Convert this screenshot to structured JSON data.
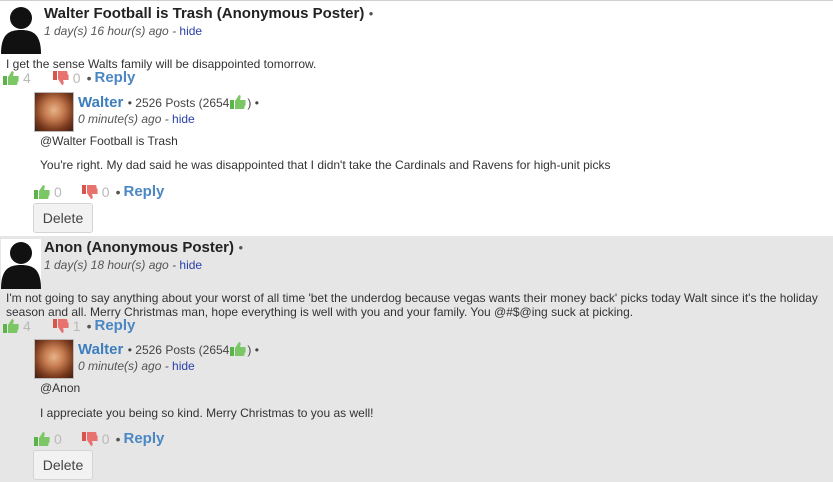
{
  "colors": {
    "accent_link": "#4a87c3",
    "hide_link": "#2a3fa8",
    "thumb_up": "#5cb34a",
    "thumb_down": "#e05a55",
    "alt_background": "#e6e6e6"
  },
  "comments": [
    {
      "poster": "Walter Football is Trash (Anonymous Poster)",
      "bullet": "•",
      "time": "1 day(s) 16 hour(s) ago -",
      "hide": "hide",
      "text": "I get the sense Walts family will be disappointed tomorrow.",
      "up_count": "4",
      "down_count": "0",
      "reply": "Reply",
      "reply_item": {
        "name": "Walter",
        "posts": "• 2526 Posts (2654",
        "posts_close": ") •",
        "time": "0 minute(s) ago -",
        "hide": "hide",
        "mention": "@Walter Football is Trash",
        "text": "You're right. My dad said he was disappointed that I didn't take the Cardinals and Ravens for high-unit picks",
        "up_count": "0",
        "down_count": "0",
        "reply": "Reply",
        "delete": "Delete"
      }
    },
    {
      "poster": "Anon (Anonymous Poster)",
      "bullet": "•",
      "time": "1 day(s) 18 hour(s) ago -",
      "hide": "hide",
      "text": "I'm not going to say anything about your worst of all time 'bet the underdog because vegas wants their money back' picks today Walt since it's the holiday season and all.  Merry Christmas man, hope everything is well with you and your family. You @#$@ing suck at picking.",
      "up_count": "4",
      "down_count": "1",
      "reply": "Reply",
      "reply_item": {
        "name": "Walter",
        "posts": "• 2526 Posts (2654",
        "posts_close": ") •",
        "time": "0 minute(s) ago -",
        "hide": "hide",
        "mention": "@Anon",
        "text": "I appreciate you being so kind. Merry Christmas to you as well!",
        "up_count": "0",
        "down_count": "0",
        "reply": "Reply",
        "delete": "Delete"
      }
    }
  ],
  "icons": {
    "avatar": "user-silhouette-icon",
    "walter_avatar": "walter-avatar-photo",
    "thumb_up": "thumbs-up-icon",
    "thumb_down": "thumbs-down-icon"
  }
}
